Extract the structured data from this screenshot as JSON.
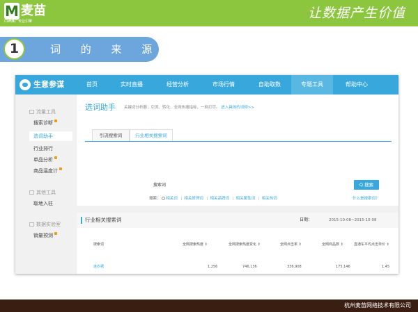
{
  "header": {
    "logo_letter": "M",
    "logo_name": "麦苗",
    "logo_sub": "口碑推广专业引擎",
    "slogan": "让数据产生价值"
  },
  "section": {
    "number": "1",
    "title": "词 的 来 源"
  },
  "app": {
    "brand": "生意参谋",
    "nav": [
      {
        "label": "首页"
      },
      {
        "label": "实时直播"
      },
      {
        "label": "经营分析"
      },
      {
        "label": "市场行情"
      },
      {
        "label": "自助取数"
      },
      {
        "label": "专题工具"
      },
      {
        "label": "帮助中心"
      }
    ],
    "sidebar": {
      "group1": "流量工具",
      "group1_items": [
        "搜索诊断",
        "选词助手",
        "行业排行",
        "单品分析",
        "商品温度计"
      ],
      "group2": "其他工具",
      "group2_items": [
        "取地入驻"
      ],
      "group3": "数据实验室",
      "group3_items": [
        "销量预测"
      ]
    },
    "tool": {
      "title": "选词助手",
      "desc": "关键词分析器：引流、转化、全网热搜指标，一网打尽。",
      "desc_link": "进入具体的词频>>",
      "tabs": [
        "引流搜索词",
        "行业相关搜索词"
      ]
    },
    "search": {
      "label": "搜索词：",
      "button": "Q 搜索",
      "row_prefix": "搜索：",
      "options": [
        "相关词",
        "相关修饰词",
        "相关品牌词",
        "相关属性词",
        "相关热词"
      ],
      "adv_link": "什么是搜索词？"
    },
    "panel": {
      "title": "行业相关搜索词",
      "date_label": "日期：",
      "date_range": "2015-10-08~2015-10-08"
    },
    "table": {
      "headers": [
        "搜索词",
        "全网搜索热度 ⇕",
        "全网搜索热度变化 ⇕",
        "全网点击率 ⇕",
        "全网商品数 ⇕",
        "直通车平均点击单价 ⇕"
      ],
      "rows": [
        [
          "连衣裙",
          "1,256",
          "746,136",
          "336,908",
          "175,146",
          "1.45"
        ]
      ]
    }
  },
  "footer": {
    "company": "杭州麦苗网络技术有限公司"
  },
  "colors": {
    "green": "#8cc63f",
    "blue_pill": "#6da5dd",
    "nav_blue": "#38a8dc",
    "bottom_brown": "#3b1e12"
  }
}
